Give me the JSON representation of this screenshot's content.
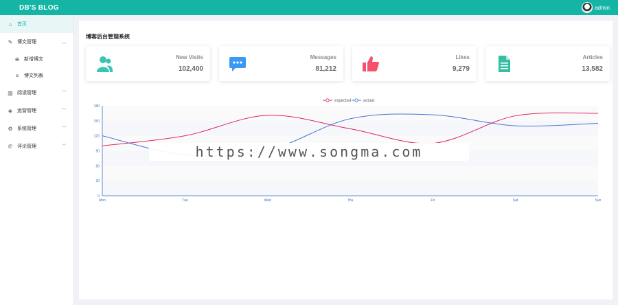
{
  "app": {
    "brand": "DB'S BLOG",
    "username": "admin"
  },
  "sidebar": {
    "items": [
      {
        "icon": "home-icon",
        "glyph": "⌂",
        "label": "首页",
        "active": true
      },
      {
        "icon": "edit-icon",
        "glyph": "✎",
        "label": "博文管理",
        "expanded": true,
        "children": [
          {
            "icon": "plus-circle-icon",
            "glyph": "⊕",
            "label": "新增博文"
          },
          {
            "icon": "list-icon",
            "glyph": "≡",
            "label": "博文列表"
          }
        ]
      },
      {
        "icon": "read-icon",
        "glyph": "▥",
        "label": "阅读管理"
      },
      {
        "icon": "shield-icon",
        "glyph": "◈",
        "label": "运营管理"
      },
      {
        "icon": "settings-icon",
        "glyph": "⚙",
        "label": "系统管理"
      },
      {
        "icon": "comment-icon",
        "glyph": "✆",
        "label": "评论管理"
      }
    ]
  },
  "main": {
    "title": "博客后台管理系统"
  },
  "cards": [
    {
      "label": "New Visits",
      "value": "102,400",
      "icon": "users-icon",
      "color": "#36c6b3"
    },
    {
      "label": "Messages",
      "value": "81,212",
      "icon": "message-icon",
      "color": "#3b98f5"
    },
    {
      "label": "Likes",
      "value": "9,279",
      "icon": "thumbs-up-icon",
      "color": "#f4516c"
    },
    {
      "label": "Articles",
      "value": "13,582",
      "icon": "document-icon",
      "color": "#34bfa3"
    }
  ],
  "watermark": "https://www.songma.com",
  "chart_data": {
    "type": "line",
    "categories": [
      "Mon",
      "Tue",
      "Wed",
      "Thu",
      "Fri",
      "Sat",
      "Sun"
    ],
    "ylim": [
      0,
      180
    ],
    "yticks": [
      0,
      30,
      60,
      90,
      120,
      150,
      180
    ],
    "series": [
      {
        "name": "expected",
        "color": "#e0235c",
        "values": [
          100,
          120,
          161,
          134,
          105,
          160,
          165
        ]
      },
      {
        "name": "actual",
        "color": "#4a72d6",
        "values": [
          120,
          82,
          91,
          154,
          162,
          140,
          145
        ]
      }
    ],
    "legend_position": "top-center",
    "smooth": true,
    "grid": false,
    "background_bands": true
  }
}
